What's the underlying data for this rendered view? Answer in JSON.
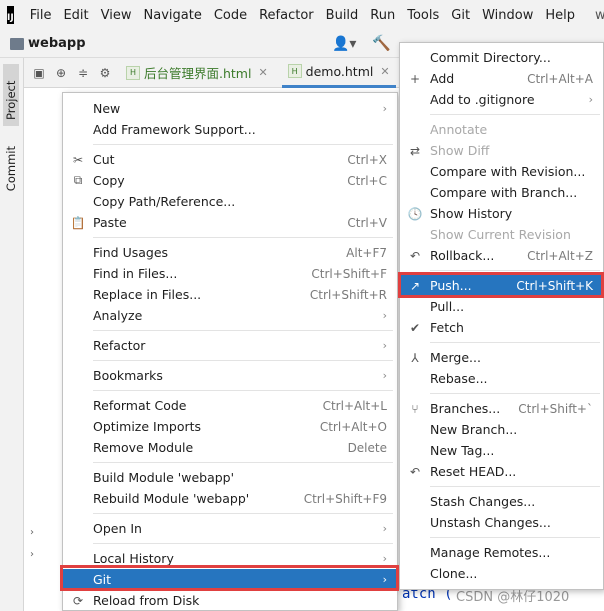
{
  "app": {
    "logo_text": "IJ",
    "window_title": "webd"
  },
  "menubar": [
    {
      "id": "file",
      "label": "File"
    },
    {
      "id": "edit",
      "label": "Edit"
    },
    {
      "id": "view",
      "label": "View"
    },
    {
      "id": "navigate",
      "label": "Navigate"
    },
    {
      "id": "code",
      "label": "Code"
    },
    {
      "id": "refactor",
      "label": "Refactor"
    },
    {
      "id": "build",
      "label": "Build"
    },
    {
      "id": "run",
      "label": "Run"
    },
    {
      "id": "tools",
      "label": "Tools"
    },
    {
      "id": "git",
      "label": "Git"
    },
    {
      "id": "window",
      "label": "Window"
    },
    {
      "id": "help",
      "label": "Help"
    }
  ],
  "navbar": {
    "project_name": "webapp"
  },
  "tool_strip": {
    "project_tab": "Project",
    "commit_tab": "Commit"
  },
  "editor_tabs": [
    {
      "id": "admin",
      "label": "后台管理界面.html",
      "badge": "H"
    },
    {
      "id": "demo",
      "label": "demo.html",
      "badge": "H"
    }
  ],
  "editor": {
    "visible_code": "atch (",
    "watermark": "CSDN @林仔1020"
  },
  "context_menu": {
    "items": [
      {
        "label": "New",
        "shortcut": "",
        "submenu": true
      },
      {
        "label": "Add Framework Support...",
        "shortcut": ""
      },
      {
        "separator": true
      },
      {
        "label": "Cut",
        "shortcut": "Ctrl+X",
        "icon": "✂"
      },
      {
        "label": "Copy",
        "shortcut": "Ctrl+C",
        "icon": "⧉"
      },
      {
        "label": "Copy Path/Reference...",
        "shortcut": ""
      },
      {
        "label": "Paste",
        "shortcut": "Ctrl+V",
        "icon": "📋"
      },
      {
        "separator": true
      },
      {
        "label": "Find Usages",
        "shortcut": "Alt+F7"
      },
      {
        "label": "Find in Files...",
        "shortcut": "Ctrl+Shift+F"
      },
      {
        "label": "Replace in Files...",
        "shortcut": "Ctrl+Shift+R"
      },
      {
        "label": "Analyze",
        "shortcut": "",
        "submenu": true
      },
      {
        "separator": true
      },
      {
        "label": "Refactor",
        "shortcut": "",
        "submenu": true
      },
      {
        "separator": true
      },
      {
        "label": "Bookmarks",
        "shortcut": "",
        "submenu": true
      },
      {
        "separator": true
      },
      {
        "label": "Reformat Code",
        "shortcut": "Ctrl+Alt+L"
      },
      {
        "label": "Optimize Imports",
        "shortcut": "Ctrl+Alt+O"
      },
      {
        "label": "Remove Module",
        "shortcut": "Delete"
      },
      {
        "separator": true
      },
      {
        "label": "Build Module 'webapp'",
        "shortcut": ""
      },
      {
        "label": "Rebuild Module 'webapp'",
        "shortcut": "Ctrl+Shift+F9"
      },
      {
        "separator": true
      },
      {
        "label": "Open In",
        "shortcut": "",
        "submenu": true
      },
      {
        "separator": true
      },
      {
        "label": "Local History",
        "shortcut": "",
        "submenu": true
      },
      {
        "label": "Git",
        "shortcut": "",
        "submenu": true,
        "selected": true
      },
      {
        "label": "Reload from Disk",
        "shortcut": "",
        "icon": "⟳"
      }
    ]
  },
  "git_submenu": {
    "items": [
      {
        "label": "Commit Directory...",
        "shortcut": ""
      },
      {
        "label": "Add",
        "shortcut": "Ctrl+Alt+A",
        "icon": "+"
      },
      {
        "label": "Add to .gitignore",
        "shortcut": "",
        "submenu": true
      },
      {
        "separator": true
      },
      {
        "label": "Annotate",
        "shortcut": "",
        "disabled": true
      },
      {
        "label": "Show Diff",
        "shortcut": "",
        "disabled": true,
        "icon": "⇄"
      },
      {
        "label": "Compare with Revision...",
        "shortcut": ""
      },
      {
        "label": "Compare with Branch...",
        "shortcut": ""
      },
      {
        "label": "Show History",
        "shortcut": "",
        "icon": "🕓"
      },
      {
        "label": "Show Current Revision",
        "shortcut": "",
        "disabled": true
      },
      {
        "label": "Rollback...",
        "shortcut": "Ctrl+Alt+Z",
        "icon": "↶"
      },
      {
        "separator": true
      },
      {
        "label": "Push...",
        "shortcut": "Ctrl+Shift+K",
        "icon": "↗",
        "selected": true
      },
      {
        "label": "Pull...",
        "shortcut": ""
      },
      {
        "label": "Fetch",
        "shortcut": "",
        "icon": "✔"
      },
      {
        "separator": true
      },
      {
        "label": "Merge...",
        "shortcut": "",
        "icon": "⅄"
      },
      {
        "label": "Rebase...",
        "shortcut": ""
      },
      {
        "separator": true
      },
      {
        "label": "Branches...",
        "shortcut": "Ctrl+Shift+`",
        "icon": "⑂"
      },
      {
        "label": "New Branch...",
        "shortcut": ""
      },
      {
        "label": "New Tag...",
        "shortcut": ""
      },
      {
        "label": "Reset HEAD...",
        "shortcut": "",
        "icon": "↶"
      },
      {
        "separator": true
      },
      {
        "label": "Stash Changes...",
        "shortcut": ""
      },
      {
        "label": "Unstash Changes...",
        "shortcut": ""
      },
      {
        "separator": true
      },
      {
        "label": "Manage Remotes...",
        "shortcut": ""
      },
      {
        "label": "Clone...",
        "shortcut": ""
      }
    ]
  },
  "colors": {
    "selection": "#2675bf",
    "highlight_border": "#e04040",
    "accent_green": "#3b7a2a"
  }
}
